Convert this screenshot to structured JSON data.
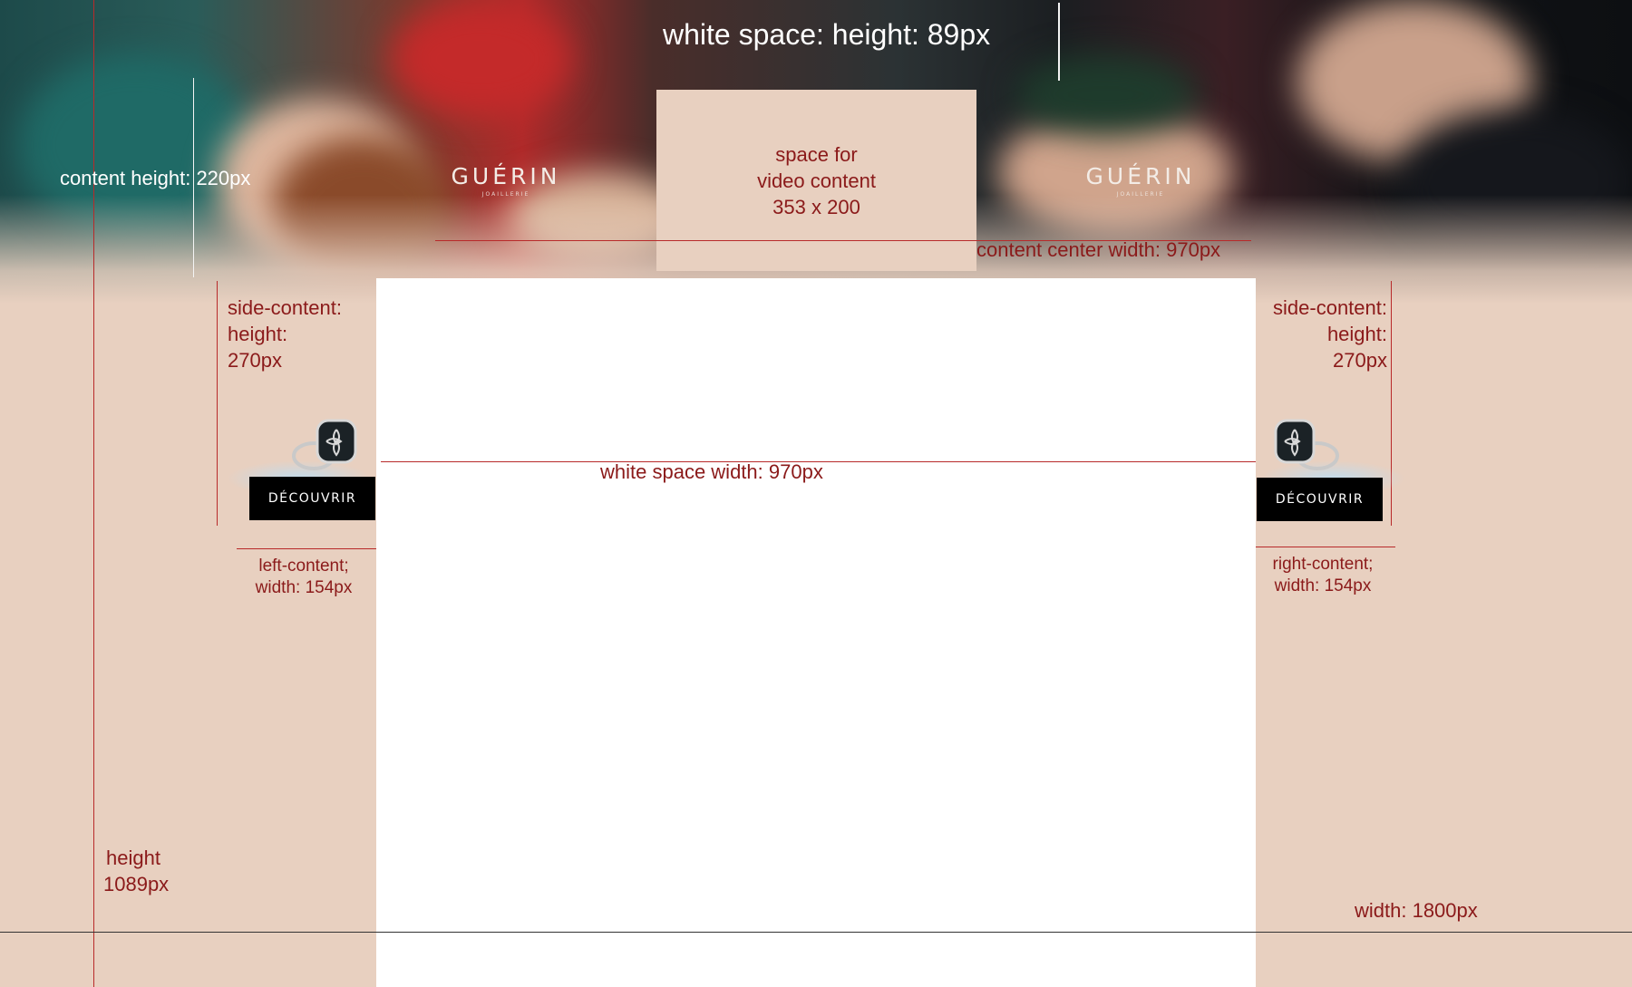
{
  "annotations": {
    "top_white_space": "white space: height: 89px",
    "content_height": "content height: 220px",
    "video_line1": "space for",
    "video_line2": "video content",
    "video_line3": "353 x 200",
    "content_center_width": "content center width: 970px",
    "side_left_1": "side-content:",
    "side_left_2": "height:",
    "side_left_3": "270px",
    "side_right_1": "side-content:",
    "side_right_2": "height:",
    "side_right_3": "270px",
    "white_space_width": "white space width: 970px",
    "left_content_1": "left-content;",
    "left_content_2": "width: 154px",
    "right_content_1": "right-content;",
    "right_content_2": "width: 154px",
    "height_1": "height",
    "height_2": "1089px",
    "total_width": "width: 1800px"
  },
  "brand": {
    "name": "GUÉRIN",
    "tagline": "JOAILLERIE"
  },
  "cta": {
    "label": "DÉCOUVRIR"
  },
  "colors": {
    "background": "#e8d0c0",
    "annotation": "#8b1a1a",
    "button": "#000000"
  }
}
